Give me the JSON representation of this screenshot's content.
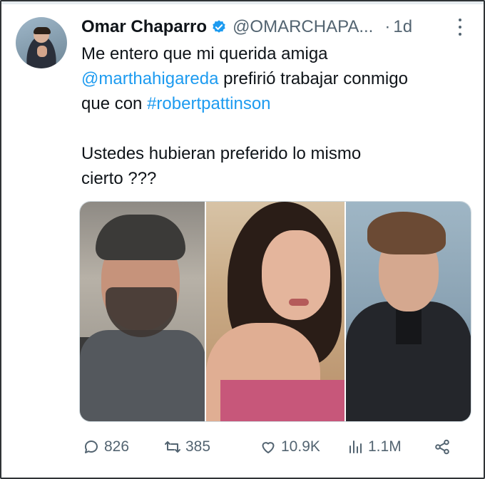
{
  "tweet": {
    "author_name": "Omar Chaparro",
    "handle": "@OMARCHAPA...",
    "separator": "·",
    "time": "1d",
    "text_line1": "Me entero que mi querida amiga",
    "mention": "@marthahigareda",
    "text_line2_rest": " prefirió trabajar conmigo",
    "text_line3_start": "que con ",
    "hashtag": "#robertpattinson",
    "text_line4": "Ustedes hubieran preferido lo mismo",
    "text_line5": "cierto ???"
  },
  "actions": {
    "replies": "826",
    "retweets": "385",
    "likes": "10.9K",
    "views": "1.1M"
  },
  "colors": {
    "link": "#1d9bf0",
    "muted": "#536471",
    "verified": "#1d9bf0",
    "text": "#0f1419"
  },
  "icons": [
    "verified-badge-icon",
    "more-options-icon",
    "reply-icon",
    "retweet-icon",
    "like-icon",
    "views-icon",
    "share-icon"
  ]
}
